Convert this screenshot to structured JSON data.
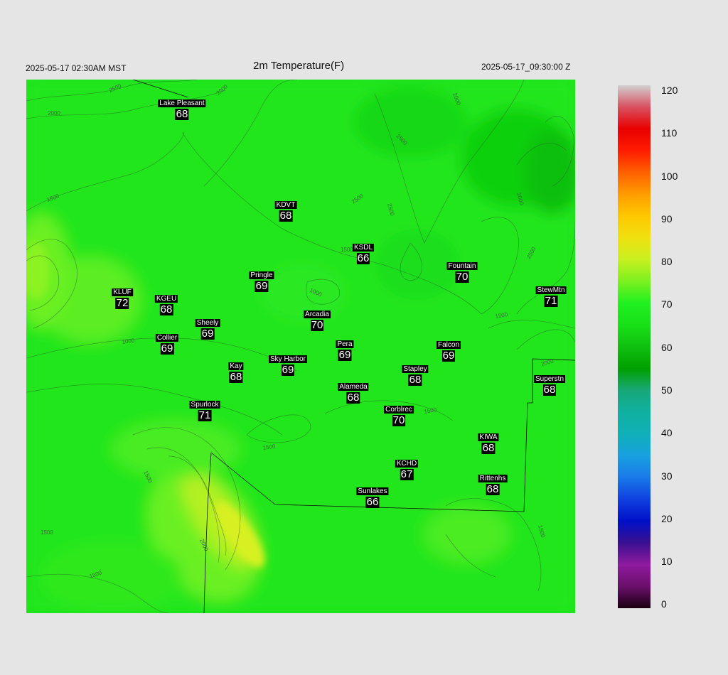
{
  "header": {
    "local_time": "2025-05-17 02:30AM MST",
    "title": "2m Temperature(F)",
    "utc_time": "2025-05-17_09:30:00 Z"
  },
  "map": {
    "field": "2m Temperature",
    "units": "F",
    "contour_labels": [
      "2500",
      "2000",
      "2000",
      "1500",
      "2500",
      "2000",
      "2500",
      "2500",
      "2000",
      "2500",
      "1500",
      "1000",
      "1000",
      "1500",
      "1500",
      "2000",
      "1500",
      "1500",
      "2000",
      "1500",
      "1500",
      "1500"
    ],
    "stations": [
      {
        "name": "Lake Pleasant",
        "temp": "68"
      },
      {
        "name": "KDVT",
        "temp": "68"
      },
      {
        "name": "KSDL",
        "temp": "66"
      },
      {
        "name": "Fountain",
        "temp": "70"
      },
      {
        "name": "StewMtn",
        "temp": "71"
      },
      {
        "name": "Pringle",
        "temp": "69"
      },
      {
        "name": "KLUF",
        "temp": "72"
      },
      {
        "name": "KGEU",
        "temp": "68"
      },
      {
        "name": "Sheely",
        "temp": "69"
      },
      {
        "name": "Arcadia",
        "temp": "70"
      },
      {
        "name": "Collier",
        "temp": "69"
      },
      {
        "name": "Pera",
        "temp": "69"
      },
      {
        "name": "Falcon",
        "temp": "69"
      },
      {
        "name": "Kay",
        "temp": "68"
      },
      {
        "name": "Sky Harbor",
        "temp": "69"
      },
      {
        "name": "Stapley",
        "temp": "68"
      },
      {
        "name": "Superstn",
        "temp": "68"
      },
      {
        "name": "Alameda",
        "temp": "68"
      },
      {
        "name": "Spurlock",
        "temp": "71"
      },
      {
        "name": "Corblrec",
        "temp": "70"
      },
      {
        "name": "KIWA",
        "temp": "68"
      },
      {
        "name": "KCHD",
        "temp": "67"
      },
      {
        "name": "Rittenhs",
        "temp": "68"
      },
      {
        "name": "Sunlakes",
        "temp": "66"
      }
    ]
  },
  "colorbar": {
    "labels": [
      "120",
      "110",
      "100",
      "90",
      "80",
      "70",
      "60",
      "50",
      "40",
      "30",
      "20",
      "10",
      "0"
    ],
    "stops": [
      {
        "value": 0,
        "color": "#1a0010"
      },
      {
        "value": 5,
        "color": "#6b0f6b"
      },
      {
        "value": 10,
        "color": "#8f1a9f"
      },
      {
        "value": 15,
        "color": "#3a1090"
      },
      {
        "value": 20,
        "color": "#0010c8"
      },
      {
        "value": 25,
        "color": "#1040e0"
      },
      {
        "value": 30,
        "color": "#1a7ae8"
      },
      {
        "value": 35,
        "color": "#18a0e0"
      },
      {
        "value": 40,
        "color": "#10b0b8"
      },
      {
        "value": 45,
        "color": "#10b0a0"
      },
      {
        "value": 50,
        "color": "#18a878"
      },
      {
        "value": 55,
        "color": "#00a000"
      },
      {
        "value": 60,
        "color": "#10c010"
      },
      {
        "value": 65,
        "color": "#18e018"
      },
      {
        "value": 70,
        "color": "#20f020"
      },
      {
        "value": 75,
        "color": "#7cf020"
      },
      {
        "value": 80,
        "color": "#c8f020"
      },
      {
        "value": 85,
        "color": "#f0e010"
      },
      {
        "value": 90,
        "color": "#ffc800"
      },
      {
        "value": 95,
        "color": "#ff9c00"
      },
      {
        "value": 100,
        "color": "#ff6000"
      },
      {
        "value": 105,
        "color": "#ff1c00"
      },
      {
        "value": 110,
        "color": "#e80000"
      },
      {
        "value": 115,
        "color": "#d85060"
      },
      {
        "value": 120,
        "color": "#d0d0d0"
      }
    ]
  }
}
